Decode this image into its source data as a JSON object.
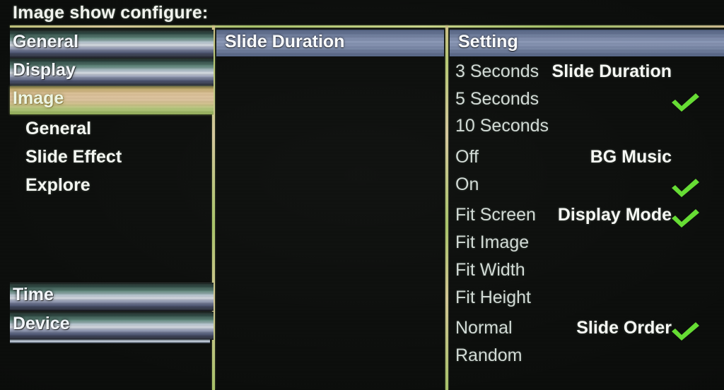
{
  "window": {
    "title": "Image show configure:",
    "accent_frame": "#b9c97a",
    "check_color": "#66dd33",
    "header_bar_color": "#7b8bae",
    "selected_row_color": "#e6c89a",
    "background": "#0b0d0b"
  },
  "sidebar": {
    "items": [
      {
        "label": "General",
        "style": "bar",
        "selected": false
      },
      {
        "label": "Display",
        "style": "bar",
        "selected": false
      },
      {
        "label": "Image",
        "style": "bar",
        "selected": true
      },
      {
        "label": "General",
        "style": "sub",
        "selected": false
      },
      {
        "label": "Slide Effect",
        "style": "sub",
        "selected": false
      },
      {
        "label": "Explore",
        "style": "sub",
        "selected": false
      },
      {
        "label": "Time",
        "style": "bar",
        "selected": false
      },
      {
        "label": "Device",
        "style": "bar",
        "selected": false
      }
    ]
  },
  "middle": {
    "header": "Slide Duration",
    "labels": [
      "Slide Duration",
      "BG Music",
      "Display Mode",
      "Slide Order"
    ]
  },
  "settings": {
    "header": "Setting",
    "options": [
      {
        "label": "3 Seconds",
        "checked": false
      },
      {
        "label": "5 Seconds",
        "checked": true
      },
      {
        "label": "10 Seconds",
        "checked": false
      },
      {
        "label": "Off",
        "checked": false
      },
      {
        "label": "On",
        "checked": true
      },
      {
        "label": "Fit Screen",
        "checked": true
      },
      {
        "label": "Fit Image",
        "checked": false
      },
      {
        "label": "Fit Width",
        "checked": false
      },
      {
        "label": "Fit Height",
        "checked": false
      },
      {
        "label": "Normal",
        "checked": true
      },
      {
        "label": "Random",
        "checked": false
      }
    ]
  }
}
